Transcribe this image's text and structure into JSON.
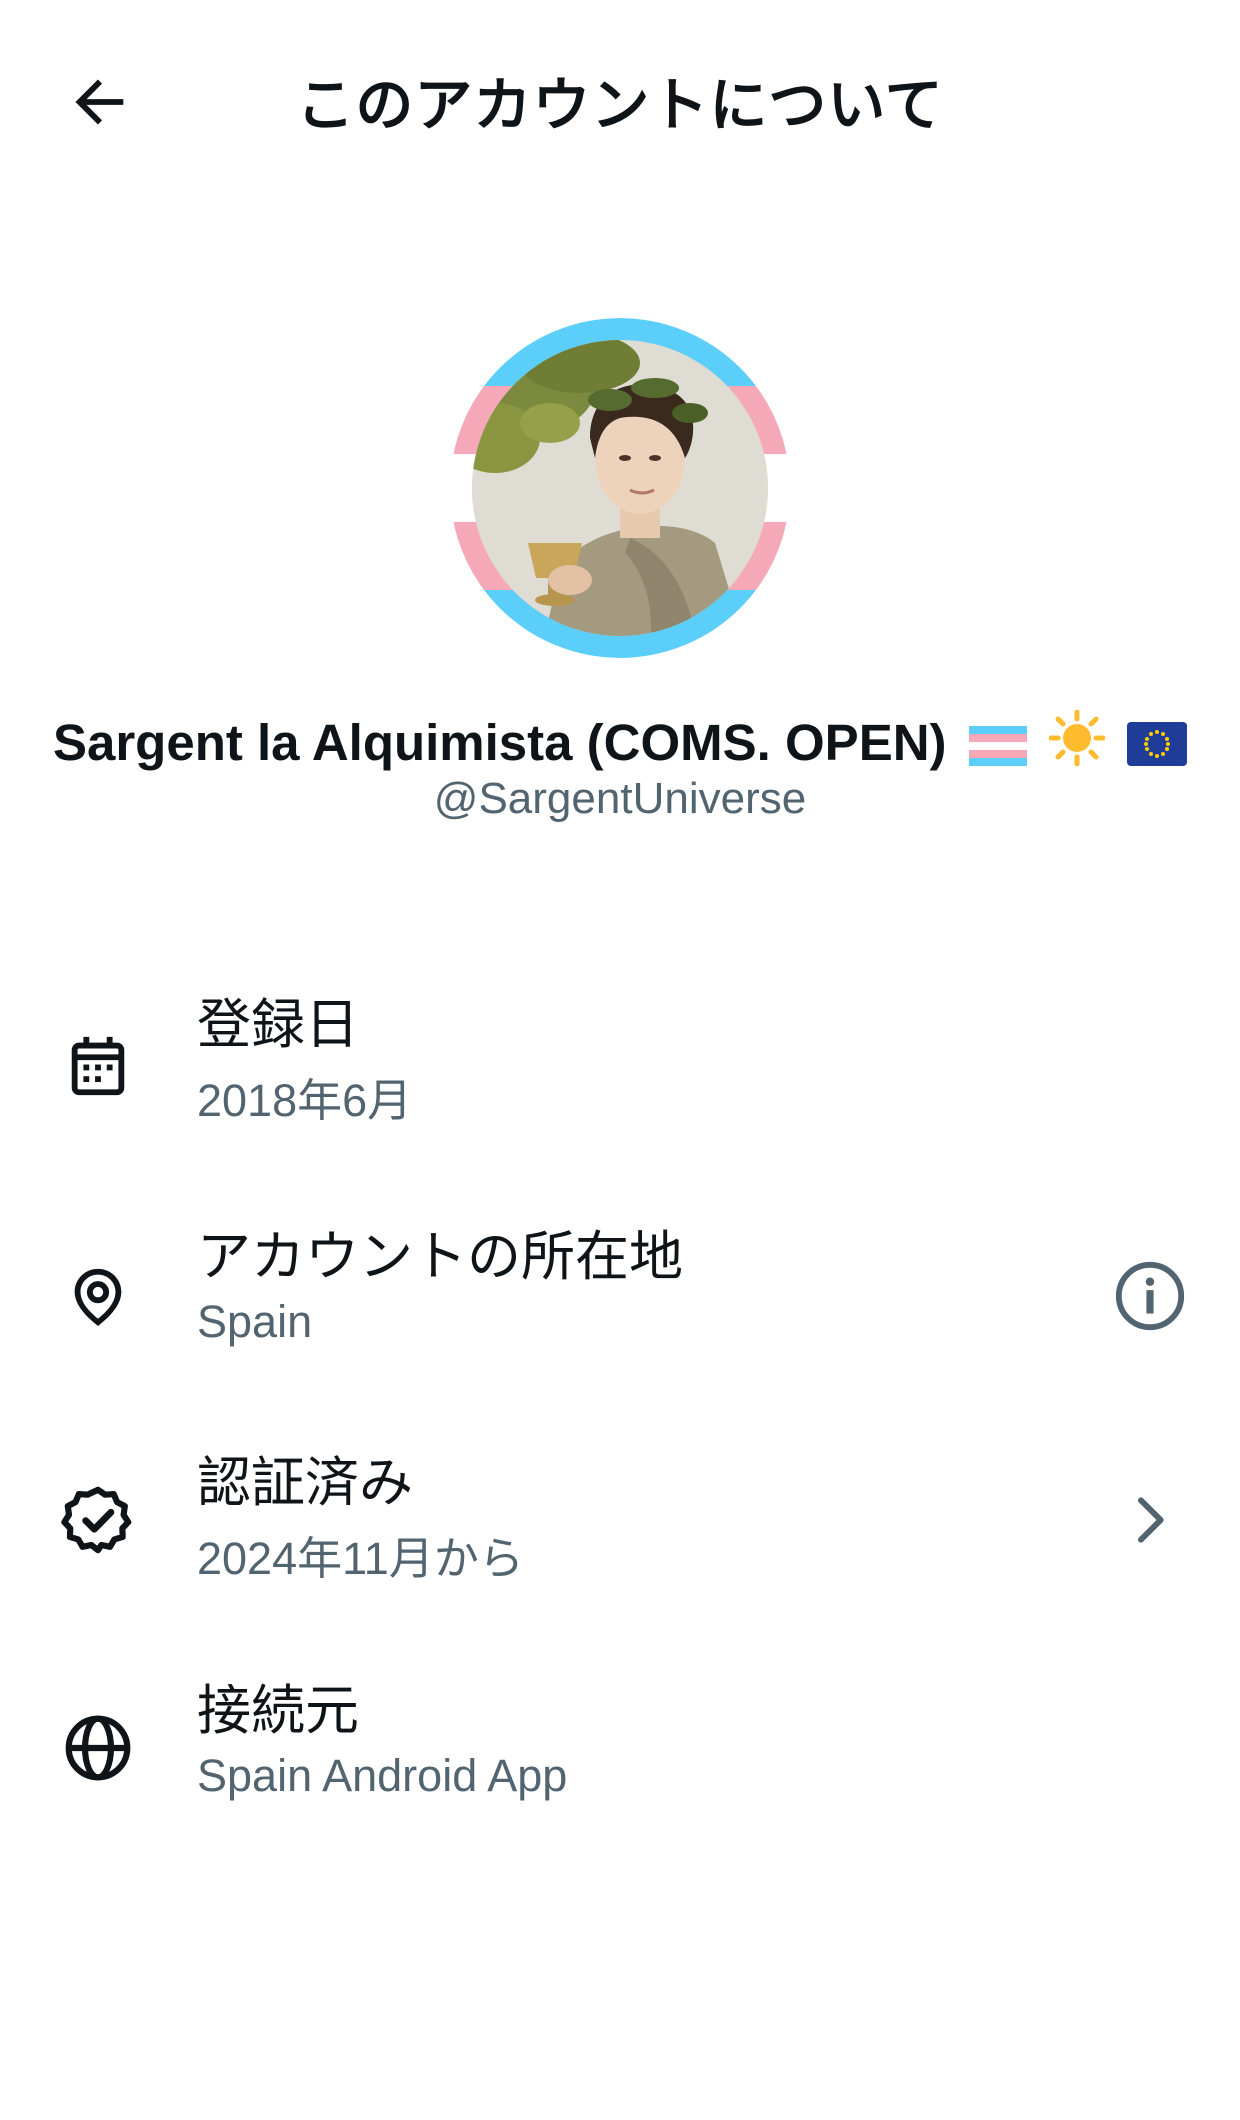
{
  "header": {
    "title": "このアカウントについて",
    "back_icon": "arrow-left-icon"
  },
  "profile": {
    "display_name": "Sargent la Alquimista (COMS. OPEN)",
    "emoji": [
      "transgender-flag",
      "sun",
      "eu-flag"
    ],
    "handle": "@SargentUniverse",
    "avatar_ring_colors": [
      "#5bcefa",
      "#f5a9b8",
      "#ffffff"
    ]
  },
  "details": [
    {
      "icon": "calendar-icon",
      "title": "登録日",
      "value": "2018年6月"
    },
    {
      "icon": "location-pin-icon",
      "title": "アカウントの所在地",
      "value": "Spain",
      "action_icon": "info-icon"
    },
    {
      "icon": "verified-badge-icon",
      "title": "認証済み",
      "value": "2024年11月から",
      "action_icon": "chevron-right-icon"
    },
    {
      "icon": "globe-icon",
      "title": "接続元",
      "value": "Spain Android App"
    }
  ],
  "colors": {
    "primary_text": "#0f1419",
    "secondary_text": "#536471",
    "background": "#ffffff"
  }
}
